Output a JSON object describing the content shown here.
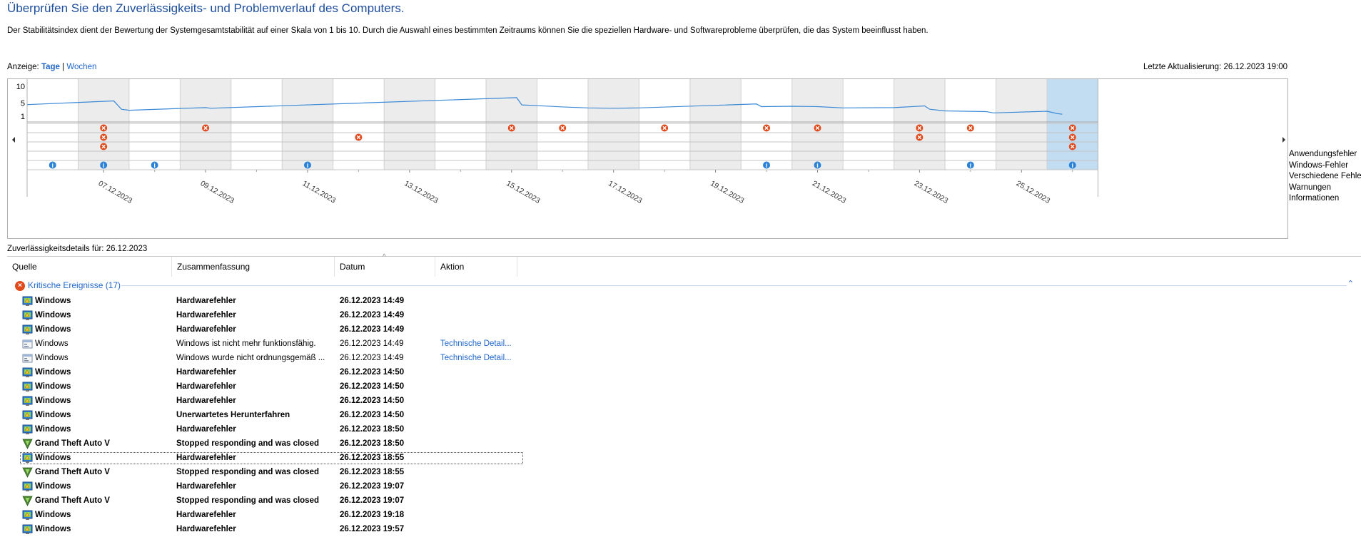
{
  "page": {
    "title": "Überprüfen Sie den Zuverlässigkeits- und Problemverlauf des Computers.",
    "description": "Der Stabilitätsindex dient der Bewertung der Systemgesamtstabilität auf einer Skala von 1 bis 10. Durch die Auswahl eines bestimmten Zeitraums können Sie die speziellen Hardware- und Softwareprobleme überprüfen, die das System beeinflusst haben."
  },
  "view": {
    "label": "Anzeige:",
    "days": "Tage",
    "separator": "|",
    "weeks": "Wochen",
    "last_update": "Letzte Aktualisierung: 26.12.2023 19:00"
  },
  "chart_data": {
    "type": "line",
    "title": "",
    "ylim": [
      1,
      10
    ],
    "yticks": [
      "10",
      "5",
      "1"
    ],
    "columns": [
      "06.12",
      "07.12",
      "08.12",
      "09.12",
      "10.12",
      "11.12",
      "12.12",
      "13.12",
      "14.12",
      "15.12",
      "16.12",
      "17.12",
      "18.12",
      "19.12",
      "20.12",
      "21.12",
      "22.12",
      "23.12",
      "24.12",
      "25.12",
      "26.12"
    ],
    "date_labels": [
      "07.12.2023",
      "09.12.2023",
      "11.12.2023",
      "13.12.2023",
      "15.12.2023",
      "17.12.2023",
      "19.12.2023",
      "21.12.2023",
      "23.12.2023",
      "25.12.2023"
    ],
    "selected_column": "26.12",
    "stability_points": [
      [
        0.0,
        4.5
      ],
      [
        1.7,
        5.6
      ],
      [
        1.85,
        3.1
      ],
      [
        2.0,
        2.8
      ],
      [
        3.5,
        3.6
      ],
      [
        3.6,
        3.4
      ],
      [
        9.6,
        6.6
      ],
      [
        9.7,
        4.4
      ],
      [
        10.0,
        4.2
      ],
      [
        10.5,
        3.8
      ],
      [
        11.0,
        3.5
      ],
      [
        11.5,
        3.4
      ],
      [
        12.0,
        3.5
      ],
      [
        14.3,
        4.7
      ],
      [
        14.4,
        3.9
      ],
      [
        15.0,
        4.0
      ],
      [
        15.5,
        3.9
      ],
      [
        16.0,
        3.5
      ],
      [
        17.0,
        3.6
      ],
      [
        17.6,
        4.1
      ],
      [
        17.7,
        3.1
      ],
      [
        18.0,
        2.6
      ],
      [
        18.8,
        2.4
      ],
      [
        18.95,
        2.0
      ],
      [
        20.0,
        2.5
      ],
      [
        20.2,
        1.8
      ],
      [
        20.3,
        1.6
      ]
    ],
    "rows": [
      "Anwendungsfehler",
      "Windows-Fehler",
      "Verschiedene Fehler",
      "Warnungen",
      "Informationen"
    ],
    "events": {
      "Anwendungsfehler": [
        "07.12",
        "09.12",
        "15.12",
        "16.12",
        "18.12",
        "20.12",
        "21.12",
        "23.12",
        "24.12",
        "26.12"
      ],
      "Windows-Fehler": [
        "07.12",
        "12.12",
        "23.12",
        "26.12"
      ],
      "Verschiedene Fehler": [
        "07.12",
        "26.12"
      ],
      "Warnungen": [],
      "Informationen": [
        "06.12",
        "07.12",
        "08.12",
        "11.12",
        "20.12",
        "21.12",
        "24.12",
        "26.12"
      ]
    }
  },
  "colors": {
    "accent": "#1f66c9",
    "title": "#1e4e9c",
    "stability_line": "#3a8ad6",
    "critical": "#e04a1c",
    "info": "#2b82d6",
    "selected_column": "#c2ddf2",
    "shaded_column": "#ececec"
  },
  "details": {
    "label": "Zuverlässigkeitsdetails für: 26.12.2023",
    "columns": [
      "Quelle",
      "Zusammenfassung",
      "Datum",
      "Aktion"
    ],
    "group": {
      "label": "Kritische Ereignisse (17)"
    },
    "rows": [
      {
        "icon": "hardware-error-icon",
        "source": "Windows",
        "summary": "Hardwarefehler",
        "date": "26.12.2023 14:49",
        "action": "",
        "bold": true
      },
      {
        "icon": "hardware-error-icon",
        "source": "Windows",
        "summary": "Hardwarefehler",
        "date": "26.12.2023 14:49",
        "action": "",
        "bold": true
      },
      {
        "icon": "hardware-error-icon",
        "source": "Windows",
        "summary": "Hardwarefehler",
        "date": "26.12.2023 14:49",
        "action": "",
        "bold": true
      },
      {
        "icon": "window-app-icon",
        "source": "Windows",
        "summary": "Windows ist nicht mehr funktionsfähig.",
        "date": "26.12.2023 14:49",
        "action": "Technische Detail...",
        "bold": false
      },
      {
        "icon": "window-app-icon",
        "source": "Windows",
        "summary": "Windows wurde nicht ordnungsgemäß ...",
        "date": "26.12.2023 14:49",
        "action": "Technische Detail...",
        "bold": false
      },
      {
        "icon": "hardware-error-icon",
        "source": "Windows",
        "summary": "Hardwarefehler",
        "date": "26.12.2023 14:50",
        "action": "",
        "bold": true
      },
      {
        "icon": "hardware-error-icon",
        "source": "Windows",
        "summary": "Hardwarefehler",
        "date": "26.12.2023 14:50",
        "action": "",
        "bold": true
      },
      {
        "icon": "hardware-error-icon",
        "source": "Windows",
        "summary": "Hardwarefehler",
        "date": "26.12.2023 14:50",
        "action": "",
        "bold": true
      },
      {
        "icon": "hardware-error-icon",
        "source": "Windows",
        "summary": "Unerwartetes Herunterfahren",
        "date": "26.12.2023 14:50",
        "action": "",
        "bold": true
      },
      {
        "icon": "hardware-error-icon",
        "source": "Windows",
        "summary": "Hardwarefehler",
        "date": "26.12.2023 18:50",
        "action": "",
        "bold": true
      },
      {
        "icon": "gta-v-icon",
        "source": "Grand Theft Auto V",
        "summary": "Stopped responding and was closed",
        "date": "26.12.2023 18:50",
        "action": "",
        "bold": true
      },
      {
        "icon": "hardware-error-icon",
        "source": "Windows",
        "summary": "Hardwarefehler",
        "date": "26.12.2023 18:55",
        "action": "",
        "bold": true,
        "selected": true
      },
      {
        "icon": "gta-v-icon",
        "source": "Grand Theft Auto V",
        "summary": "Stopped responding and was closed",
        "date": "26.12.2023 18:55",
        "action": "",
        "bold": true
      },
      {
        "icon": "hardware-error-icon",
        "source": "Windows",
        "summary": "Hardwarefehler",
        "date": "26.12.2023 19:07",
        "action": "",
        "bold": true
      },
      {
        "icon": "gta-v-icon",
        "source": "Grand Theft Auto V",
        "summary": "Stopped responding and was closed",
        "date": "26.12.2023 19:07",
        "action": "",
        "bold": true
      },
      {
        "icon": "hardware-error-icon",
        "source": "Windows",
        "summary": "Hardwarefehler",
        "date": "26.12.2023 19:18",
        "action": "",
        "bold": true
      },
      {
        "icon": "hardware-error-icon",
        "source": "Windows",
        "summary": "Hardwarefehler",
        "date": "26.12.2023 19:57",
        "action": "",
        "bold": true
      }
    ]
  }
}
